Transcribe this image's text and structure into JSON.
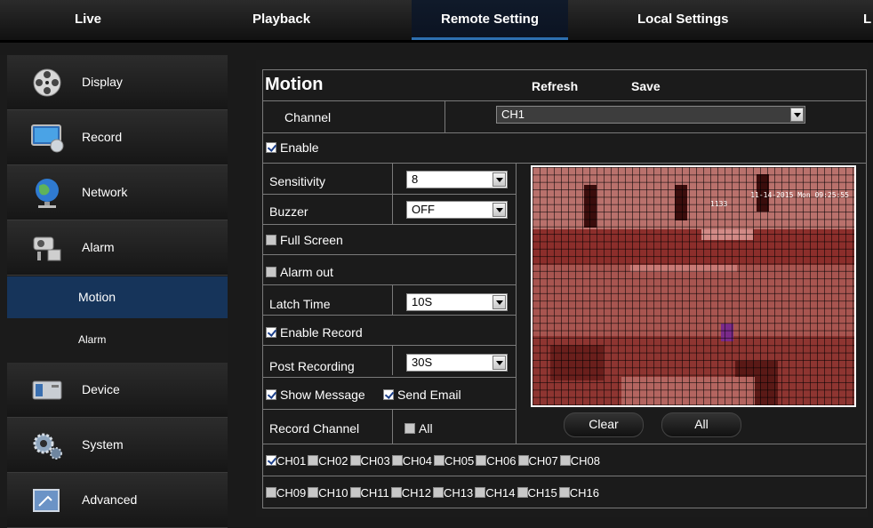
{
  "nav": {
    "tabs": [
      {
        "label": "Live"
      },
      {
        "label": "Playback"
      },
      {
        "label": "Remote Setting"
      },
      {
        "label": "Local Settings"
      },
      {
        "label": "L"
      }
    ]
  },
  "sidebar": {
    "items": [
      {
        "label": "Display",
        "icon": "film-reel-icon"
      },
      {
        "label": "Record",
        "icon": "monitor-icon"
      },
      {
        "label": "Network",
        "icon": "globe-icon"
      },
      {
        "label": "Alarm",
        "icon": "alarm-camera-icon"
      },
      {
        "label": "Motion"
      },
      {
        "label": "Alarm"
      },
      {
        "label": "Device",
        "icon": "hard-drive-icon"
      },
      {
        "label": "System",
        "icon": "gears-icon"
      },
      {
        "label": "Advanced",
        "icon": "advanced-icon"
      }
    ]
  },
  "panel": {
    "title": "Motion",
    "refresh": "Refresh",
    "save": "Save",
    "channel_label": "Channel",
    "channel_value": "CH1",
    "enable_label": "Enable",
    "sensitivity_label": "Sensitivity",
    "sensitivity_value": "8",
    "buzzer_label": "Buzzer",
    "buzzer_value": "OFF",
    "fullscreen_label": "Full Screen",
    "alarmout_label": "Alarm out",
    "latch_label": "Latch Time",
    "latch_value": "10S",
    "enable_record_label": "Enable Record",
    "post_label": "Post Recording",
    "post_value": "30S",
    "show_message_label": "Show Message",
    "send_email_label": "Send Email",
    "record_channel_label": "Record Channel",
    "all_label": "All",
    "clear_button": "Clear",
    "all_button": "All",
    "preview_timestamp": "11-14-2015 Mon 09:25:55",
    "preview_cam_label": "1133",
    "channels_row1": [
      "CH01",
      "CH02",
      "CH03",
      "CH04",
      "CH05",
      "CH06",
      "CH07",
      "CH08"
    ],
    "channels_row2": [
      "CH09",
      "CH10",
      "CH11",
      "CH12",
      "CH13",
      "CH14",
      "CH15",
      "CH16"
    ]
  },
  "colors": {
    "accent": "#2d6fb0",
    "active_sidebar": "#16345a",
    "motion_overlay": "#c0302c"
  }
}
